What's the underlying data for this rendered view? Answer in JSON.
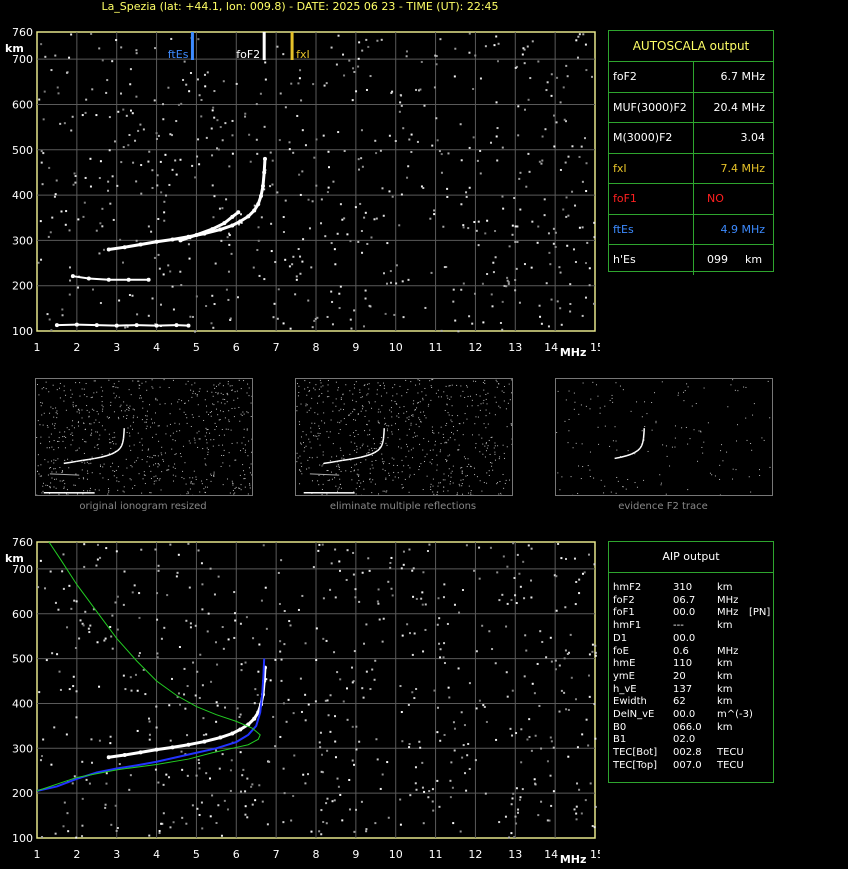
{
  "header": {
    "title": "La_Spezia (lat: +44.1, lon: 009.8) - DATE:  2025 06 23 - TIME (UT):  22:45"
  },
  "axes": {
    "y_unit": "km",
    "x_unit": "MHz",
    "y_ticks": [
      "100",
      "200",
      "300",
      "400",
      "500",
      "600",
      "700",
      "760"
    ],
    "x_ticks": [
      "1",
      "2",
      "3",
      "4",
      "5",
      "6",
      "7",
      "8",
      "9",
      "10",
      "11",
      "12",
      "13",
      "14",
      "15"
    ]
  },
  "markers": {
    "ftEs": "ftEs",
    "foF2": "foF2",
    "fxI": "fxI"
  },
  "autoscala": {
    "title": "AUTOSCALA output",
    "rows": [
      {
        "label": "foF2",
        "value": "6.7 MHz",
        "color": "#ffffff"
      },
      {
        "label": "MUF(3000)F2",
        "value": "20.4 MHz",
        "color": "#ffffff"
      },
      {
        "label": "M(3000)F2",
        "value": "3.04",
        "color": "#ffffff"
      },
      {
        "label": "fxI",
        "value": "7.4 MHz",
        "color": "#e6c229"
      },
      {
        "label": "foF1",
        "value": "NO",
        "color": "#ff2020"
      },
      {
        "label": "ftEs",
        "value": "4.9 MHz",
        "color": "#3d8bff"
      },
      {
        "label": "h'Es",
        "value": "099",
        "unit": "km",
        "color": "#ffffff"
      }
    ]
  },
  "thumbnails": [
    {
      "caption": "original ionogram resized"
    },
    {
      "caption": "eliminate multiple reflections"
    },
    {
      "caption": "evidence F2 trace"
    }
  ],
  "aip": {
    "title": "AIP output",
    "rows": [
      {
        "label": "hmF2",
        "value": "310",
        "unit": "km",
        "extra": ""
      },
      {
        "label": "foF2",
        "value": "06.7",
        "unit": "MHz",
        "extra": ""
      },
      {
        "label": "foF1",
        "value": "00.0",
        "unit": "MHz",
        "extra": "[PN]"
      },
      {
        "label": "hmF1",
        "value": "---",
        "unit": "km",
        "extra": ""
      },
      {
        "label": "D1",
        "value": "00.0",
        "unit": "",
        "extra": ""
      },
      {
        "label": "foE",
        "value": "0.6",
        "unit": "MHz",
        "extra": ""
      },
      {
        "label": "hmE",
        "value": "110",
        "unit": "km",
        "extra": ""
      },
      {
        "label": "ymE",
        "value": "20",
        "unit": "km",
        "extra": ""
      },
      {
        "label": "h_vE",
        "value": "137",
        "unit": "km",
        "extra": ""
      },
      {
        "label": "Ewidth",
        "value": "62",
        "unit": "km",
        "extra": ""
      },
      {
        "label": "DelN_vE",
        "value": "00.0",
        "unit": "m^(-3)",
        "extra": ""
      },
      {
        "label": "B0",
        "value": "066.0",
        "unit": "km",
        "extra": ""
      },
      {
        "label": "B1",
        "value": "02.0",
        "unit": "",
        "extra": ""
      },
      {
        "label": "TEC[Bot]",
        "value": "002.8",
        "unit": "TECU",
        "extra": ""
      },
      {
        "label": "TEC[Top]",
        "value": "007.0",
        "unit": "TECU",
        "extra": ""
      }
    ]
  },
  "colors": {
    "frame": "#e6e68a",
    "grid": "#5a5a5a",
    "trace": "#ffffff",
    "profile_green": "#22cc22",
    "profile_blue": "#2233ff",
    "ftEs_marker": "#3d8bff",
    "fxI_marker": "#e6c229"
  },
  "chart_data": [
    {
      "type": "scatter",
      "xlim": [
        1,
        15
      ],
      "ylim": [
        100,
        760
      ],
      "x_scale": "linear",
      "y_scale": "linear",
      "grid": true,
      "series": [
        {
          "values": [
            [
              2.8,
              280
            ],
            [
              3.2,
              285
            ],
            [
              3.6,
              291
            ],
            [
              4.0,
              297
            ],
            [
              4.4,
              302
            ],
            [
              4.8,
              308
            ],
            [
              5.2,
              315
            ],
            [
              5.6,
              324
            ],
            [
              5.9,
              333
            ],
            [
              6.1,
              342
            ],
            [
              6.3,
              353
            ],
            [
              6.45,
              366
            ],
            [
              6.55,
              380
            ],
            [
              6.62,
              398
            ],
            [
              6.67,
              420
            ],
            [
              6.7,
              450
            ],
            [
              6.72,
              480
            ]
          ]
        },
        {
          "values": [
            [
              4.6,
              300
            ],
            [
              5.0,
              312
            ],
            [
              5.4,
              325
            ],
            [
              5.7,
              338
            ],
            [
              5.9,
              352
            ],
            [
              6.05,
              362
            ]
          ]
        },
        {
          "values": [
            [
              1.5,
              113
            ],
            [
              2.0,
              114
            ],
            [
              2.5,
              113
            ],
            [
              3.0,
              112
            ],
            [
              3.5,
              113
            ],
            [
              4.0,
              112
            ],
            [
              4.5,
              113
            ],
            [
              4.8,
              112
            ]
          ]
        },
        {
          "values": [
            [
              1.9,
              221
            ],
            [
              2.3,
              216
            ],
            [
              2.8,
              213
            ],
            [
              3.3,
              213
            ],
            [
              3.8,
              213
            ]
          ]
        }
      ],
      "vertical_markers": [
        {
          "name": "ftEs",
          "x": 4.9
        },
        {
          "name": "foF2",
          "x": 6.7
        },
        {
          "name": "fxI",
          "x": 7.4
        }
      ]
    },
    {
      "type": "line",
      "xlim": [
        1,
        15
      ],
      "ylim": [
        100,
        760
      ],
      "grid": true,
      "series": [
        {
          "values": [
            [
              2.8,
              280
            ],
            [
              3.2,
              285
            ],
            [
              3.6,
              291
            ],
            [
              4.0,
              297
            ],
            [
              4.4,
              302
            ],
            [
              4.8,
              308
            ],
            [
              5.2,
              315
            ],
            [
              5.6,
              324
            ],
            [
              5.9,
              333
            ],
            [
              6.1,
              342
            ],
            [
              6.3,
              353
            ],
            [
              6.45,
              366
            ],
            [
              6.55,
              380
            ],
            [
              6.62,
              398
            ],
            [
              6.67,
              420
            ],
            [
              6.7,
              450
            ],
            [
              6.72,
              480
            ]
          ]
        },
        {
          "values": [
            [
              1.0,
              205
            ],
            [
              1.5,
              215
            ],
            [
              2.0,
              232
            ],
            [
              2.5,
              246
            ],
            [
              3.0,
              255
            ],
            [
              3.5,
              262
            ],
            [
              4.0,
              270
            ],
            [
              4.5,
              280
            ],
            [
              5.0,
              290
            ],
            [
              5.5,
              300
            ],
            [
              6.0,
              314
            ],
            [
              6.3,
              330
            ],
            [
              6.5,
              350
            ],
            [
              6.6,
              380
            ],
            [
              6.65,
              420
            ],
            [
              6.68,
              460
            ],
            [
              6.7,
              500
            ]
          ]
        },
        {
          "values": [
            [
              1.0,
              205
            ],
            [
              2.0,
              235
            ],
            [
              3.0,
              252
            ],
            [
              4.0,
              264
            ],
            [
              4.8,
              276
            ],
            [
              5.4,
              290
            ],
            [
              5.9,
              300
            ],
            [
              6.3,
              308
            ],
            [
              6.55,
              320
            ],
            [
              6.6,
              330
            ],
            [
              6.4,
              345
            ],
            [
              6.0,
              360
            ],
            [
              5.5,
              375
            ],
            [
              5.0,
              393
            ],
            [
              4.5,
              418
            ],
            [
              4.0,
              450
            ],
            [
              3.5,
              495
            ],
            [
              3.0,
              545
            ],
            [
              2.5,
              605
            ],
            [
              2.0,
              665
            ],
            [
              1.6,
              720
            ],
            [
              1.3,
              760
            ]
          ]
        }
      ]
    }
  ]
}
